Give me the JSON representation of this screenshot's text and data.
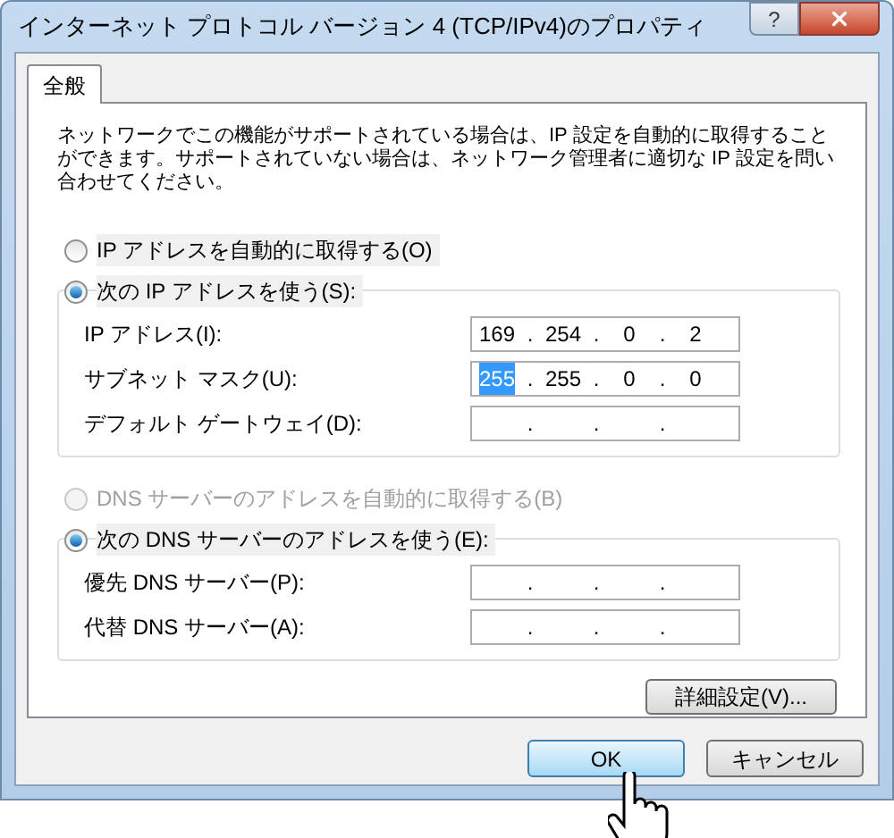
{
  "window": {
    "title": "インターネット プロトコル バージョン 4 (TCP/IPv4)のプロパティ",
    "help_button": "?"
  },
  "tabs": [
    {
      "label": "全般",
      "selected": true
    }
  ],
  "description": "ネットワークでこの機能がサポートされている場合は、IP 設定を自動的に取得することができます。サポートされていない場合は、ネットワーク管理者に適切な IP 設定を問い合わせてください。",
  "sections": [
    {
      "auto_option": {
        "label": "IP アドレスを自動的に取得する(O)",
        "selected": false,
        "disabled": false
      },
      "manual_option": {
        "label": "次の IP アドレスを使う(S):",
        "selected": true,
        "disabled": false
      },
      "fields": [
        {
          "label": "IP アドレス(I):",
          "separator": ".",
          "octets": [
            {
              "text": "169",
              "selected": false
            },
            {
              "text": "254",
              "selected": false
            },
            {
              "text": "0",
              "selected": false
            },
            {
              "text": "2",
              "selected": false
            }
          ]
        },
        {
          "label": "サブネット マスク(U):",
          "separator": ".",
          "octets": [
            {
              "text": "255",
              "selected": true
            },
            {
              "text": "255",
              "selected": false
            },
            {
              "text": "0",
              "selected": false
            },
            {
              "text": "0",
              "selected": false
            }
          ]
        },
        {
          "label": "デフォルト ゲートウェイ(D):",
          "separator": "."
        }
      ]
    },
    {
      "auto_option": {
        "label": "DNS サーバーのアドレスを自動的に取得する(B)",
        "selected": false,
        "disabled": true
      },
      "manual_option": {
        "label": "次の DNS サーバーのアドレスを使う(E):",
        "selected": true,
        "disabled": false
      },
      "fields": [
        {
          "label": "優先 DNS サーバー(P):",
          "separator": "."
        },
        {
          "label": "代替 DNS サーバー(A):",
          "separator": "."
        }
      ]
    }
  ],
  "advanced_button": "詳細設定(V)...",
  "buttons": [
    {
      "label": "OK",
      "kind": "default"
    },
    {
      "label": "キャンセル",
      "kind": "normal"
    }
  ]
}
